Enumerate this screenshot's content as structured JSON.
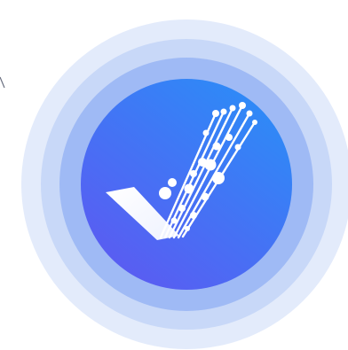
{
  "logo": {
    "icon_name": "checkmark-circuit-icon",
    "colors": {
      "outer_ring": "#e3ebfb",
      "middle_ring": "#c8d8f8",
      "inner_ring": "#9fbaf5",
      "core_start": "#5a5cf2",
      "core_end": "#2e8af7",
      "check_fill": "#ffffff",
      "stray_mark": "#6a6f80"
    }
  }
}
